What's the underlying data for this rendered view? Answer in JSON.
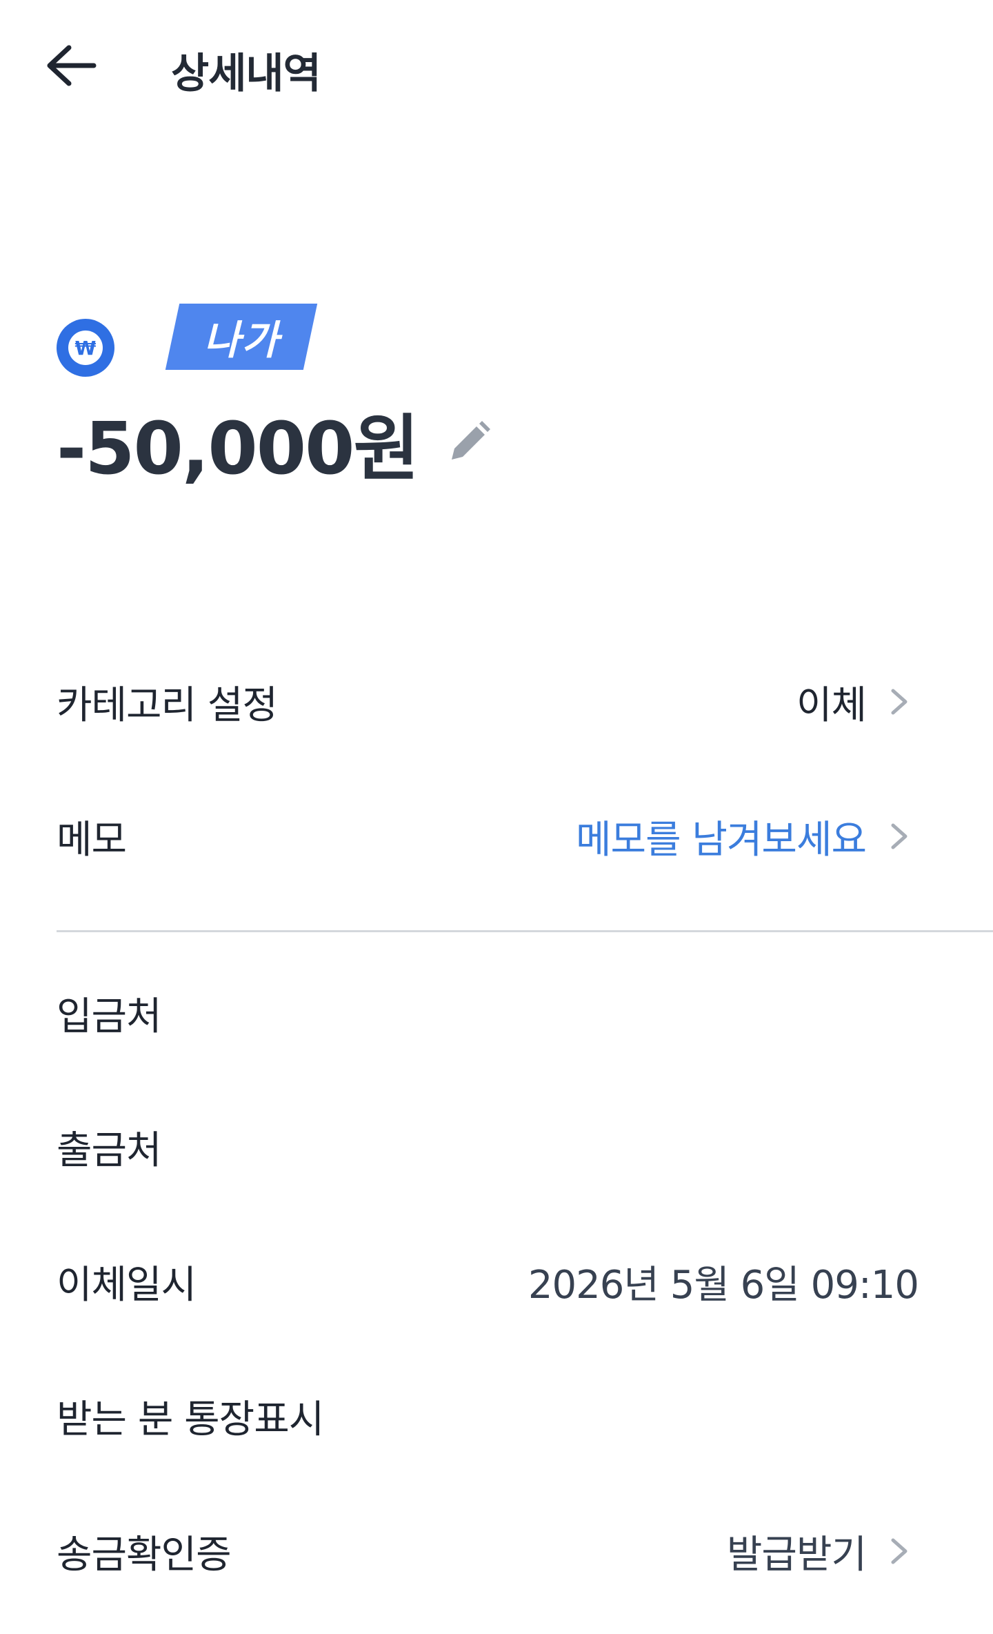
{
  "header": {
    "title": "상세내역"
  },
  "summary": {
    "account_name_hidden": "",
    "account_badge": "나가",
    "amount": "-50,000원"
  },
  "rows": {
    "category": {
      "label": "카테고리 설정",
      "value": "이체"
    },
    "memo": {
      "label": "메모",
      "value": "메모를 남겨보세요"
    },
    "deposit_to": {
      "label": "입금처",
      "value": ""
    },
    "withdraw_from": {
      "label": "출금처",
      "value": ""
    },
    "transfer_datetime": {
      "label": "이체일시",
      "value": "2026년 5월 6일 09:10"
    },
    "recipient_display": {
      "label": "받는 분 통장표시",
      "value": ""
    },
    "transfer_certificate": {
      "label": "송금확인증",
      "value": "발급받기"
    }
  },
  "icons": {
    "back": "arrow-left-icon",
    "bank": "won-coin-icon",
    "edit": "pencil-icon",
    "chevron": "chevron-right-icon"
  },
  "colors": {
    "accent": "#3b7ddd",
    "badge": "#4f86ee",
    "bank_logo": "#2f6fe3",
    "text": "#1f2530"
  }
}
